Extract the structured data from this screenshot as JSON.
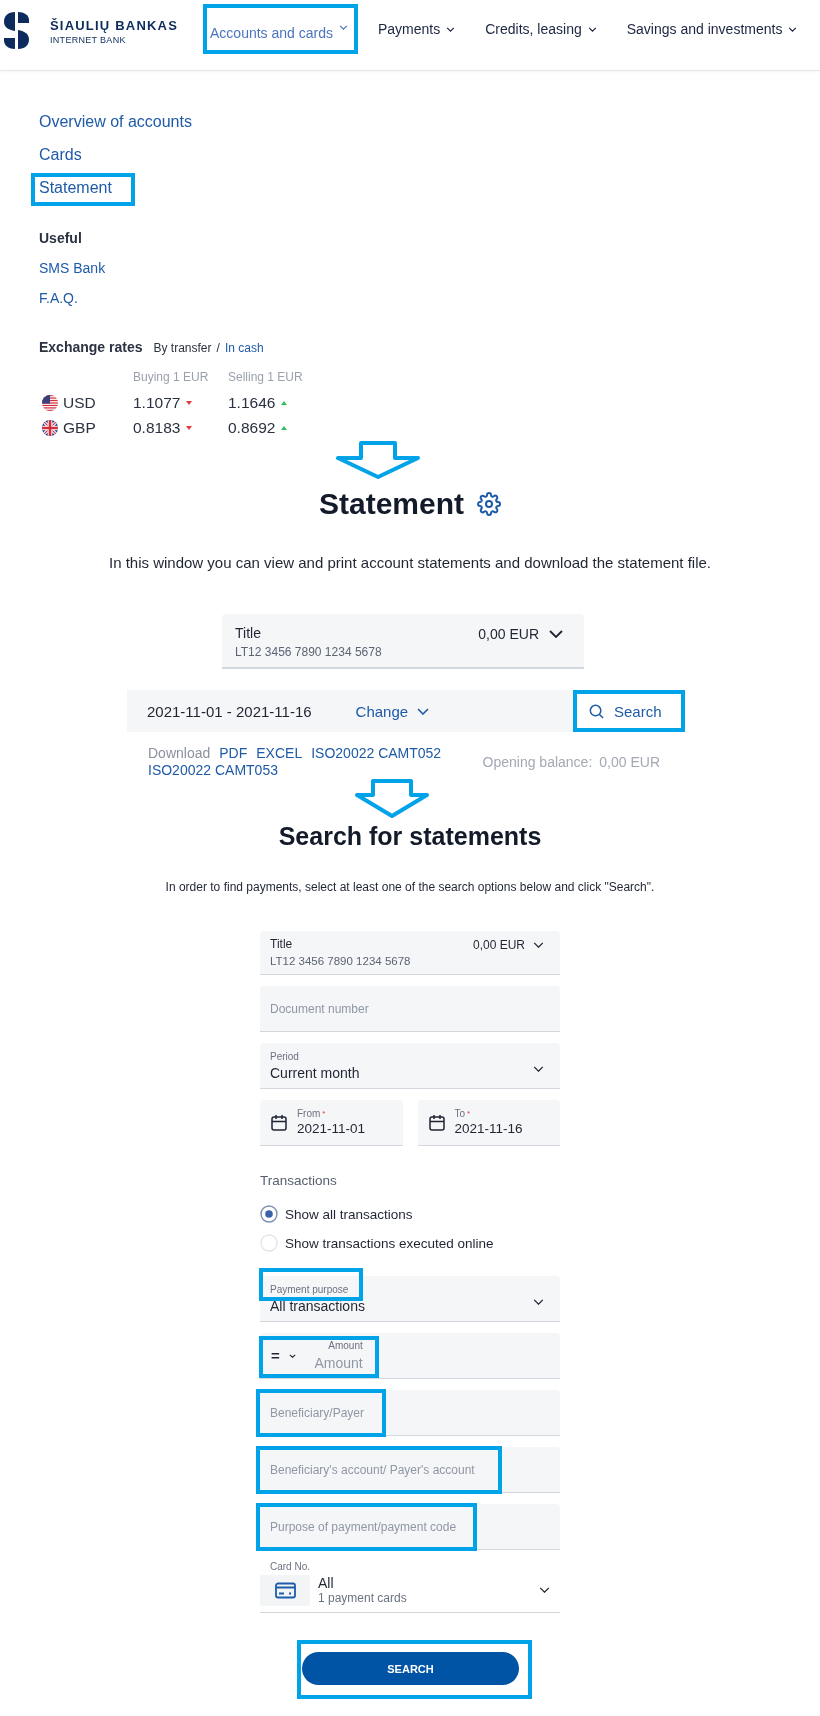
{
  "header": {
    "logo": {
      "name": "ŠIAULIŲ BANKAS",
      "subtitle": "INTERNET BANK"
    },
    "nav": [
      {
        "label": "Accounts and cards",
        "selected": true,
        "highlighted": true
      },
      {
        "label": "Payments",
        "selected": false,
        "highlighted": false
      },
      {
        "label": "Credits, leasing",
        "selected": false,
        "highlighted": false
      },
      {
        "label": "Savings and investments",
        "selected": false,
        "highlighted": false
      }
    ]
  },
  "sidebar": {
    "links": [
      {
        "label": "Overview of accounts",
        "highlighted": false
      },
      {
        "label": "Cards",
        "highlighted": false
      },
      {
        "label": "Statement",
        "highlighted": true
      }
    ],
    "useful": {
      "title": "Useful",
      "links": [
        "SMS Bank",
        "F.A.Q."
      ]
    },
    "exchange_rates": {
      "title": "Exchange rates",
      "modes": [
        {
          "label": "By transfer",
          "selected": true
        },
        {
          "label": "In cash",
          "selected": false
        }
      ],
      "separator": "/",
      "columns": [
        "Buying 1 EUR",
        "Selling 1 EUR"
      ],
      "rows": [
        {
          "kind": "us",
          "currency": "USD",
          "buying": "1.1077",
          "buying_rising": false,
          "selling": "1.1646",
          "selling_rising": true
        },
        {
          "kind": "uk",
          "currency": "GBP",
          "buying": "0.8183",
          "buying_rising": false,
          "selling": "0.8692",
          "selling_rising": true
        }
      ]
    }
  },
  "statement": {
    "title": "Statement",
    "description": "In this window you can view and print account statements and download the statement file.",
    "account": {
      "title": "Title",
      "iban": "LT12 3456 7890 1234 5678",
      "balance": "0,00 EUR"
    },
    "period": {
      "range": "2021-11-01 - 2021-11-16",
      "change": "Change",
      "search": {
        "label": "Search",
        "highlighted": true
      }
    },
    "download": {
      "label": "Download",
      "formats": [
        "PDF",
        "EXCEL",
        "ISO20022 CAMT052",
        "ISO20022 CAMT053"
      ]
    },
    "opening_balance": {
      "label": "Opening balance:",
      "value": "0,00 EUR"
    }
  },
  "search": {
    "title": "Search for statements",
    "description": "In order to find payments, select at least one of the search options below and click \"Search\".",
    "fields": [
      {
        "kind": "account",
        "title": "Title",
        "iban": "LT12 3456 7890 1234 5678",
        "balance": "0,00 EUR",
        "highlighted": false
      },
      {
        "kind": "text",
        "placeholder": "Document number",
        "highlighted": false
      },
      {
        "kind": "select",
        "label": "Period",
        "value": "Current month",
        "highlighted": false
      },
      {
        "kind": "dates",
        "highlighted": false,
        "items": [
          {
            "label": "From",
            "required_mark": "*",
            "value": "2021-11-01"
          },
          {
            "label": "To",
            "required_mark": "*",
            "value": "2021-11-16"
          }
        ]
      },
      {
        "kind": "radio_group",
        "highlighted": false,
        "title": "Transactions",
        "options": [
          {
            "label": "Show all transactions",
            "selected": true
          },
          {
            "label": "Show transactions executed online",
            "selected": false
          }
        ]
      },
      {
        "kind": "select",
        "label": "Payment purpose",
        "value": "All transactions",
        "highlighted": true
      },
      {
        "kind": "amount",
        "operator": "=",
        "label": "Amount",
        "placeholder": "Amount",
        "highlighted": true
      },
      {
        "kind": "text",
        "placeholder": "Beneficiary/Payer",
        "highlighted": true
      },
      {
        "kind": "text",
        "placeholder": "Beneficiary's account/ Payer's account",
        "highlighted": true
      },
      {
        "kind": "text",
        "placeholder": "Purpose of payment/payment code",
        "highlighted": true
      },
      {
        "kind": "card",
        "label": "Card No.",
        "value": "All",
        "note": "1 payment cards",
        "highlighted": false
      }
    ],
    "button": {
      "label": "SEARCH",
      "highlighted": true
    }
  }
}
